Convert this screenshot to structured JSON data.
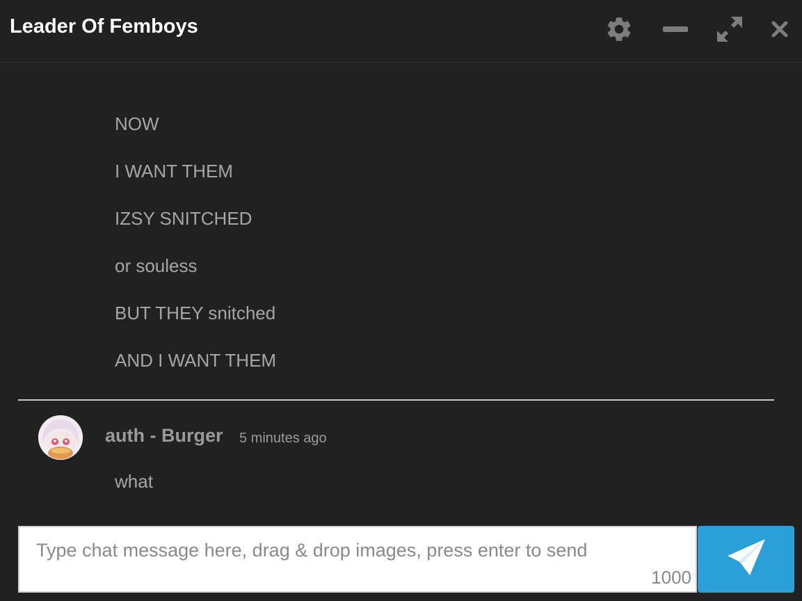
{
  "header": {
    "title": "Leader Of Femboys",
    "controls": [
      "gear-icon",
      "minimize-icon",
      "expand-icon",
      "close-icon"
    ]
  },
  "messages": {
    "lines": [
      "NOW",
      "I WANT THEM",
      "IZSY SNITCHED",
      "or souless",
      "BUT THEY snitched",
      "AND I WANT THEM"
    ],
    "latest": {
      "author": "auth - Burger",
      "timestamp": "5 minutes ago",
      "text": "what"
    }
  },
  "composer": {
    "placeholder": "Type chat message here, drag & drop images, press enter to send",
    "char_count": "1000"
  },
  "colors": {
    "background": "#212121",
    "text_muted": "#a6a6a6",
    "send_button": "#2b9fd8"
  }
}
